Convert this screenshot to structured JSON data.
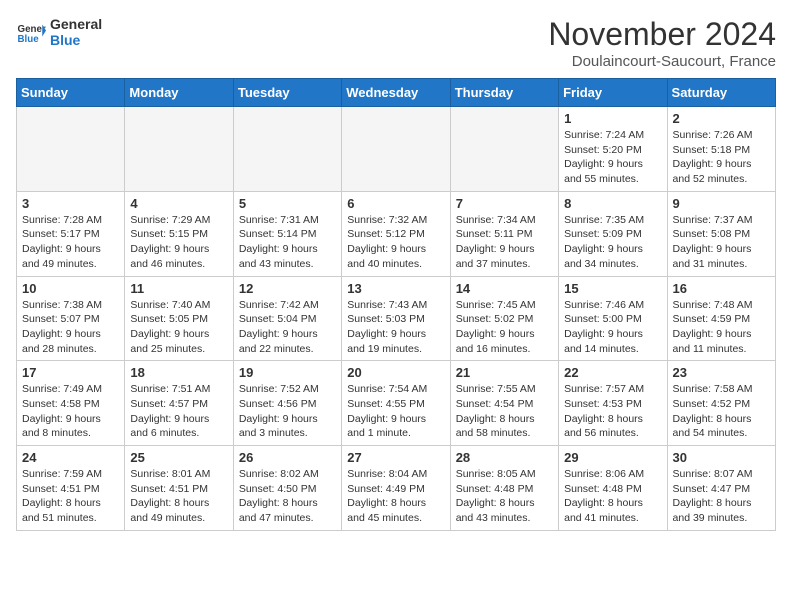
{
  "header": {
    "logo_general": "General",
    "logo_blue": "Blue",
    "month": "November 2024",
    "location": "Doulaincourt-Saucourt, France"
  },
  "weekdays": [
    "Sunday",
    "Monday",
    "Tuesday",
    "Wednesday",
    "Thursday",
    "Friday",
    "Saturday"
  ],
  "weeks": [
    [
      {
        "day": "",
        "info": ""
      },
      {
        "day": "",
        "info": ""
      },
      {
        "day": "",
        "info": ""
      },
      {
        "day": "",
        "info": ""
      },
      {
        "day": "",
        "info": ""
      },
      {
        "day": "1",
        "info": "Sunrise: 7:24 AM\nSunset: 5:20 PM\nDaylight: 9 hours and 55 minutes."
      },
      {
        "day": "2",
        "info": "Sunrise: 7:26 AM\nSunset: 5:18 PM\nDaylight: 9 hours and 52 minutes."
      }
    ],
    [
      {
        "day": "3",
        "info": "Sunrise: 7:28 AM\nSunset: 5:17 PM\nDaylight: 9 hours and 49 minutes."
      },
      {
        "day": "4",
        "info": "Sunrise: 7:29 AM\nSunset: 5:15 PM\nDaylight: 9 hours and 46 minutes."
      },
      {
        "day": "5",
        "info": "Sunrise: 7:31 AM\nSunset: 5:14 PM\nDaylight: 9 hours and 43 minutes."
      },
      {
        "day": "6",
        "info": "Sunrise: 7:32 AM\nSunset: 5:12 PM\nDaylight: 9 hours and 40 minutes."
      },
      {
        "day": "7",
        "info": "Sunrise: 7:34 AM\nSunset: 5:11 PM\nDaylight: 9 hours and 37 minutes."
      },
      {
        "day": "8",
        "info": "Sunrise: 7:35 AM\nSunset: 5:09 PM\nDaylight: 9 hours and 34 minutes."
      },
      {
        "day": "9",
        "info": "Sunrise: 7:37 AM\nSunset: 5:08 PM\nDaylight: 9 hours and 31 minutes."
      }
    ],
    [
      {
        "day": "10",
        "info": "Sunrise: 7:38 AM\nSunset: 5:07 PM\nDaylight: 9 hours and 28 minutes."
      },
      {
        "day": "11",
        "info": "Sunrise: 7:40 AM\nSunset: 5:05 PM\nDaylight: 9 hours and 25 minutes."
      },
      {
        "day": "12",
        "info": "Sunrise: 7:42 AM\nSunset: 5:04 PM\nDaylight: 9 hours and 22 minutes."
      },
      {
        "day": "13",
        "info": "Sunrise: 7:43 AM\nSunset: 5:03 PM\nDaylight: 9 hours and 19 minutes."
      },
      {
        "day": "14",
        "info": "Sunrise: 7:45 AM\nSunset: 5:02 PM\nDaylight: 9 hours and 16 minutes."
      },
      {
        "day": "15",
        "info": "Sunrise: 7:46 AM\nSunset: 5:00 PM\nDaylight: 9 hours and 14 minutes."
      },
      {
        "day": "16",
        "info": "Sunrise: 7:48 AM\nSunset: 4:59 PM\nDaylight: 9 hours and 11 minutes."
      }
    ],
    [
      {
        "day": "17",
        "info": "Sunrise: 7:49 AM\nSunset: 4:58 PM\nDaylight: 9 hours and 8 minutes."
      },
      {
        "day": "18",
        "info": "Sunrise: 7:51 AM\nSunset: 4:57 PM\nDaylight: 9 hours and 6 minutes."
      },
      {
        "day": "19",
        "info": "Sunrise: 7:52 AM\nSunset: 4:56 PM\nDaylight: 9 hours and 3 minutes."
      },
      {
        "day": "20",
        "info": "Sunrise: 7:54 AM\nSunset: 4:55 PM\nDaylight: 9 hours and 1 minute."
      },
      {
        "day": "21",
        "info": "Sunrise: 7:55 AM\nSunset: 4:54 PM\nDaylight: 8 hours and 58 minutes."
      },
      {
        "day": "22",
        "info": "Sunrise: 7:57 AM\nSunset: 4:53 PM\nDaylight: 8 hours and 56 minutes."
      },
      {
        "day": "23",
        "info": "Sunrise: 7:58 AM\nSunset: 4:52 PM\nDaylight: 8 hours and 54 minutes."
      }
    ],
    [
      {
        "day": "24",
        "info": "Sunrise: 7:59 AM\nSunset: 4:51 PM\nDaylight: 8 hours and 51 minutes."
      },
      {
        "day": "25",
        "info": "Sunrise: 8:01 AM\nSunset: 4:51 PM\nDaylight: 8 hours and 49 minutes."
      },
      {
        "day": "26",
        "info": "Sunrise: 8:02 AM\nSunset: 4:50 PM\nDaylight: 8 hours and 47 minutes."
      },
      {
        "day": "27",
        "info": "Sunrise: 8:04 AM\nSunset: 4:49 PM\nDaylight: 8 hours and 45 minutes."
      },
      {
        "day": "28",
        "info": "Sunrise: 8:05 AM\nSunset: 4:48 PM\nDaylight: 8 hours and 43 minutes."
      },
      {
        "day": "29",
        "info": "Sunrise: 8:06 AM\nSunset: 4:48 PM\nDaylight: 8 hours and 41 minutes."
      },
      {
        "day": "30",
        "info": "Sunrise: 8:07 AM\nSunset: 4:47 PM\nDaylight: 8 hours and 39 minutes."
      }
    ]
  ]
}
